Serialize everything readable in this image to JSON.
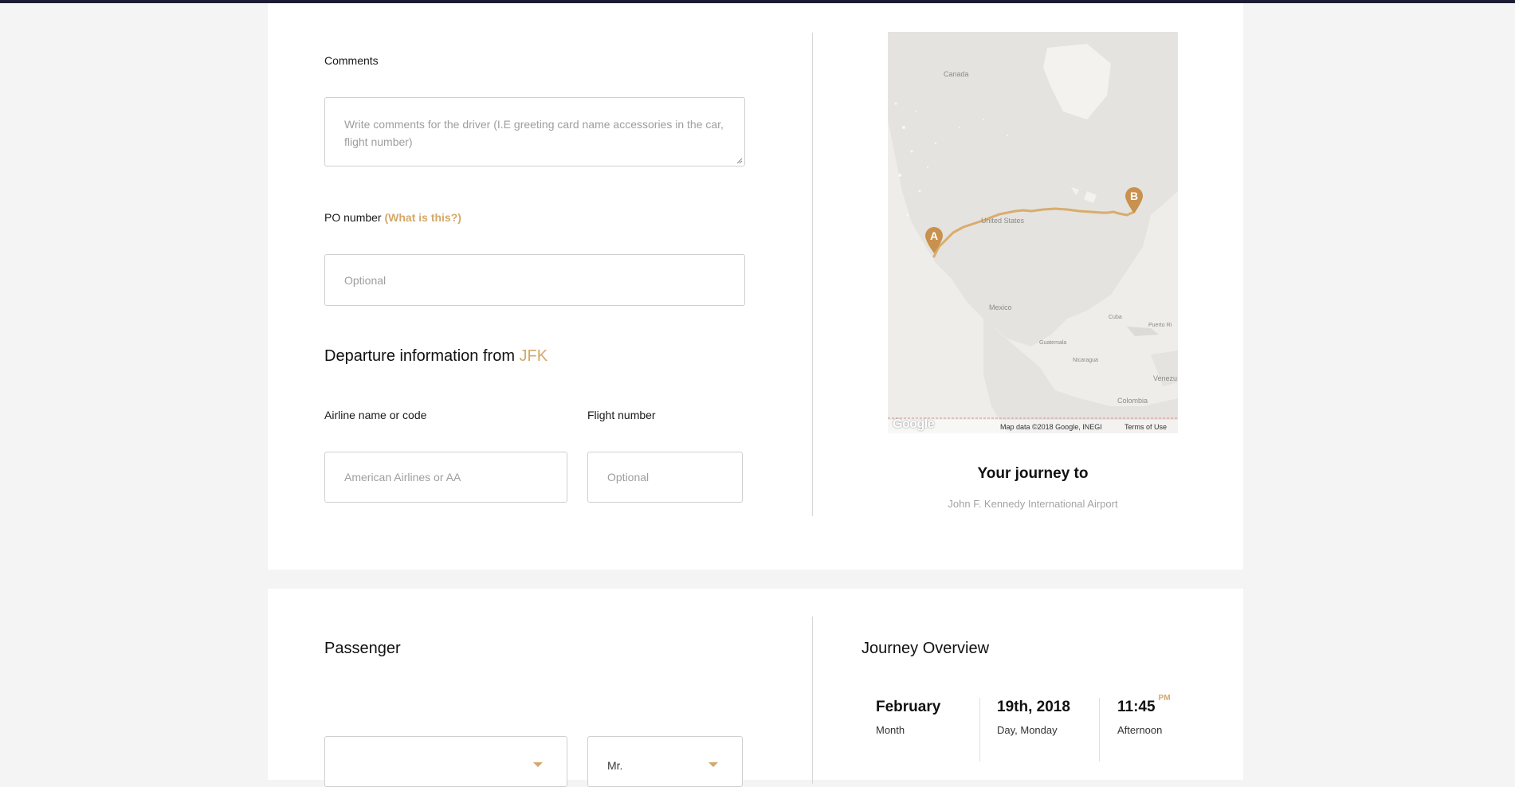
{
  "accent_color": "#d4a86a",
  "comments": {
    "label": "Comments",
    "placeholder": "Write comments for the driver (I.E greeting card name accessories in the car, flight number)"
  },
  "po": {
    "label": "PO number",
    "help_link": "(What is this?)",
    "placeholder": "Optional"
  },
  "departure": {
    "heading_prefix": "Departure information from",
    "airport_code": "JFK",
    "airline_label": "Airline name or code",
    "airline_placeholder": "American Airlines or AA",
    "flight_label": "Flight number",
    "flight_placeholder": "Optional"
  },
  "map": {
    "labels": {
      "canada": "Canada",
      "united_states": "United States",
      "mexico": "Mexico",
      "cuba": "Cuba",
      "puerto_rico": "Puerto Ri",
      "guatemala": "Guatemala",
      "nicaragua": "Nicaragua",
      "venezuela": "Venezu",
      "colombia": "Colombia"
    },
    "marker_a": "A",
    "marker_b": "B",
    "logo": "Google",
    "attribution": "Map data ©2018 Google, INEGI",
    "terms": "Terms of Use",
    "route_color": "#d9ac6e"
  },
  "journey": {
    "title": "Your journey to",
    "destination": "John F. Kennedy International Airport"
  },
  "passenger": {
    "heading": "Passenger",
    "first_select_value": "",
    "title_select_value": "Mr."
  },
  "overview": {
    "heading": "Journey Overview",
    "month_value": "February",
    "month_label": "Month",
    "day_value": "19th, 2018",
    "day_label": "Day, Monday",
    "time_value": "11:45",
    "time_suffix": "PM",
    "time_label": "Afternoon"
  }
}
